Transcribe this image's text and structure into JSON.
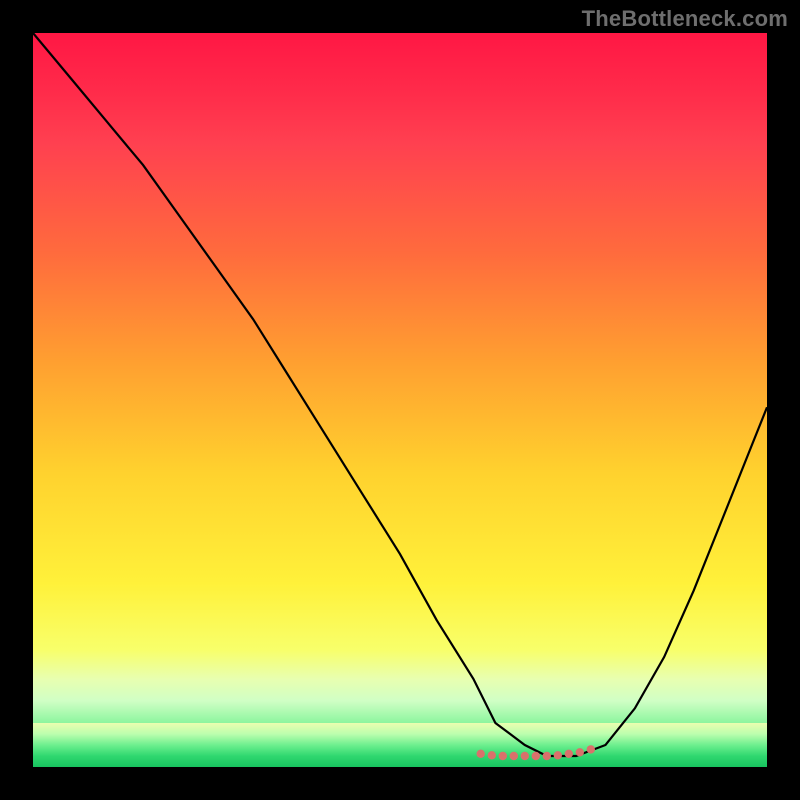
{
  "watermark": {
    "text": "TheBottleneck.com"
  },
  "chart_data": {
    "type": "line",
    "title": "",
    "xlabel": "",
    "ylabel": "",
    "xlim": [
      0,
      100
    ],
    "ylim": [
      0,
      100
    ],
    "grid": false,
    "legend": false,
    "series": [
      {
        "name": "curve",
        "color": "#000000",
        "x": [
          0,
          5,
          10,
          15,
          20,
          25,
          30,
          35,
          40,
          45,
          50,
          55,
          60,
          63,
          67,
          70,
          74,
          78,
          82,
          86,
          90,
          94,
          98,
          100
        ],
        "values": [
          100,
          94,
          88,
          82,
          75,
          68,
          61,
          53,
          45,
          37,
          29,
          20,
          12,
          6,
          3,
          1.5,
          1.5,
          3,
          8,
          15,
          24,
          34,
          44,
          49
        ]
      },
      {
        "name": "valley-marker",
        "color": "#d9716b",
        "type": "scatter",
        "x": [
          61,
          62.5,
          64,
          65.5,
          67,
          68.5,
          70,
          71.5,
          73,
          74.5,
          76
        ],
        "values": [
          1.8,
          1.6,
          1.5,
          1.5,
          1.5,
          1.5,
          1.5,
          1.6,
          1.8,
          2.0,
          2.4
        ]
      }
    ],
    "background_gradient": {
      "top": "#ff1744",
      "mid": "#ffd22e",
      "bottom": "#18c85c"
    }
  }
}
